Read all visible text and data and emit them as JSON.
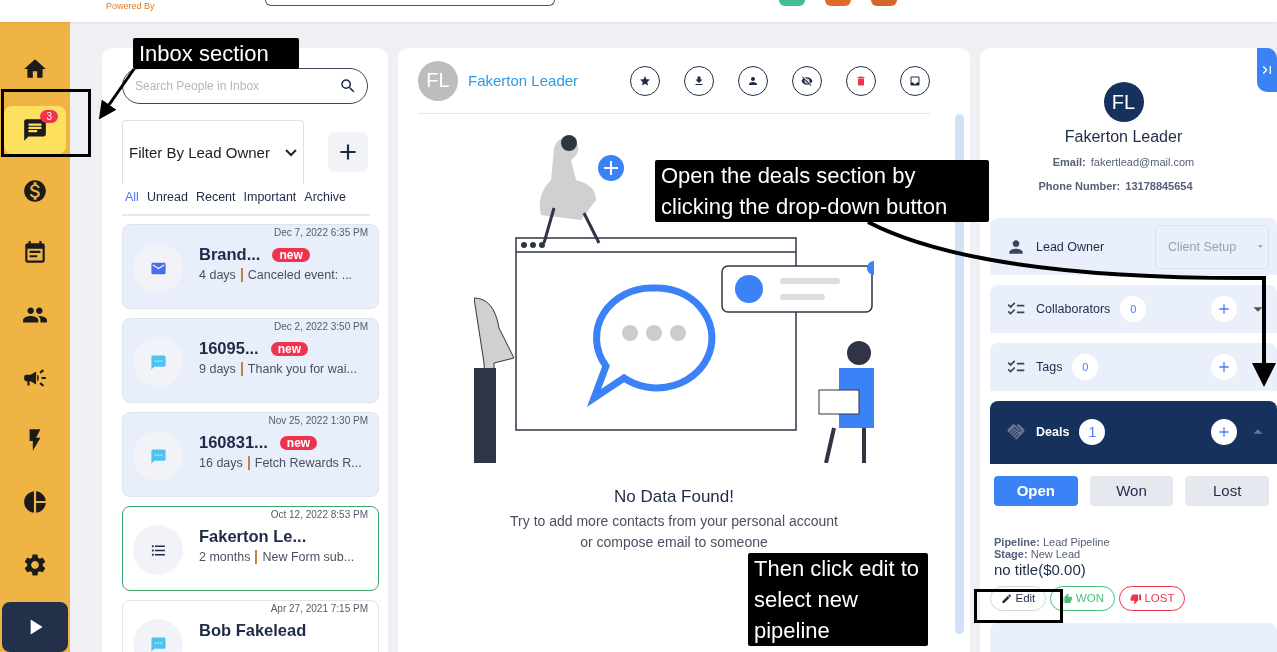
{
  "header": {
    "powered_by": "Powered By"
  },
  "sidebar": {
    "items": [
      {
        "kind": "home",
        "selected": false
      },
      {
        "kind": "chat",
        "selected": true,
        "badge": "3"
      },
      {
        "kind": "dollar",
        "selected": false
      },
      {
        "kind": "calendar",
        "selected": false
      },
      {
        "kind": "people",
        "selected": false
      },
      {
        "kind": "megaphone",
        "selected": false
      },
      {
        "kind": "bolt",
        "selected": false
      },
      {
        "kind": "pie",
        "selected": false
      },
      {
        "kind": "settings",
        "selected": false
      },
      {
        "kind": "play",
        "selected": false
      }
    ]
  },
  "inbox": {
    "search": {
      "placeholder": "Search People in Inbox"
    },
    "filter": {
      "value": "Filter By Lead Owner"
    },
    "tabs": [
      {
        "label": "All",
        "selected": true
      },
      {
        "label": "Unread",
        "selected": false
      },
      {
        "label": "Recent",
        "selected": false
      },
      {
        "label": "Important",
        "selected": false
      },
      {
        "label": "Archive",
        "selected": false
      }
    ],
    "conversations": [
      {
        "kind": "email",
        "date": "Dec 7, 2022 6:35 PM",
        "name": "Brand...",
        "badge": "new",
        "age": "4 days",
        "preview": "Canceled event: ...",
        "unread": true,
        "selected": false
      },
      {
        "kind": "chat",
        "date": "Dec 2, 2022 3:50 PM",
        "name": "16095...",
        "badge": "new",
        "age": "9 days",
        "preview": "Thank you for wai...",
        "unread": true,
        "selected": false
      },
      {
        "kind": "chat",
        "date": "Nov 25, 2022 1:30 PM",
        "name": "160831...",
        "badge": "new",
        "age": "16 days",
        "preview": "Fetch Rewards R...",
        "unread": true,
        "selected": false
      },
      {
        "kind": "form",
        "date": "Oct 12, 2022 8:53 PM",
        "name": "Fakerton Le...",
        "age": "2 months",
        "preview": "New Form sub...",
        "unread": false,
        "selected": true
      },
      {
        "kind": "chat",
        "date": "Apr 27, 2021 7:15 PM",
        "name": "Bob Fakelead",
        "unread": false,
        "selected": false
      }
    ]
  },
  "conversation": {
    "initials": "FL",
    "name": "Fakerton Leader",
    "actions": [
      {
        "kind": "star"
      },
      {
        "kind": "download"
      },
      {
        "kind": "person"
      },
      {
        "kind": "hide"
      },
      {
        "kind": "delete"
      },
      {
        "kind": "inbox"
      }
    ],
    "empty_title": "No Data Found!",
    "empty_message": "Try to add more contacts from your personal account or compose email to someone"
  },
  "contact": {
    "initials": "FL",
    "name": "Fakerton Leader",
    "email_label": "Email:",
    "email": "fakertlead@mail.com",
    "phone_label": "Phone Number:",
    "phone": "13178845654",
    "lead_owner": {
      "label": "Lead Owner",
      "value": "Client Setup"
    },
    "sections": [
      {
        "label": "Collaborators",
        "count": "0",
        "expanded": false
      },
      {
        "label": "Tags",
        "count": "0"
      }
    ],
    "deals": {
      "label": "Deals",
      "count": "1",
      "expanded": true,
      "tabs": [
        {
          "label": "Open",
          "selected": true
        },
        {
          "label": "Won",
          "selected": false
        },
        {
          "label": "Lost",
          "selected": false
        }
      ],
      "deal": {
        "pipeline_label": "Pipeline:",
        "pipeline": "Lead Pipeline",
        "stage_label": "Stage:",
        "stage": "New Lead",
        "title": "no title($0.00)",
        "edit": "Edit",
        "won": "WON",
        "lost": "LOST"
      }
    }
  },
  "annotations": [
    {
      "text": "Inbox section"
    },
    {
      "text": "Open the deals section by clicking the drop-down button"
    },
    {
      "text": "Then click edit to select new pipeline"
    }
  ]
}
